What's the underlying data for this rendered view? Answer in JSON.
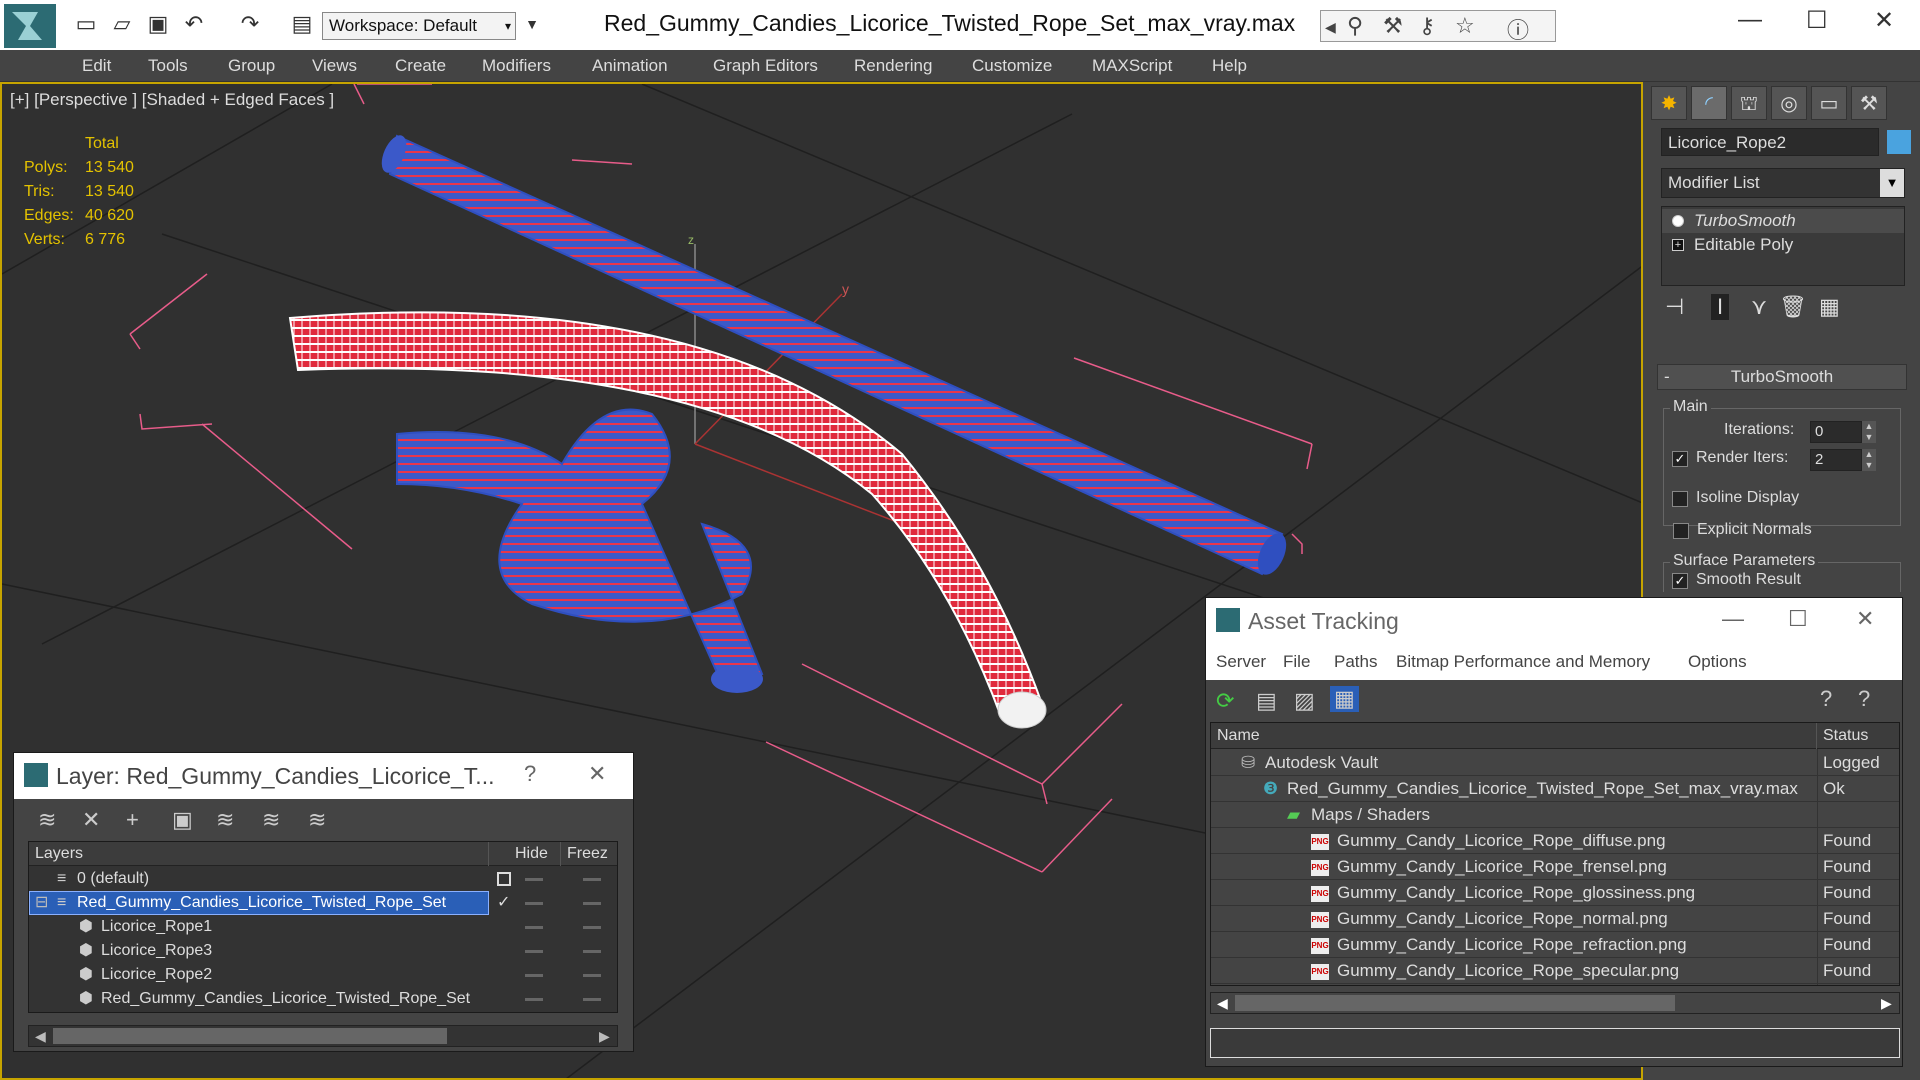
{
  "window": {
    "title": "Red_Gummy_Candies_Licorice_Twisted_Rope_Set_max_vray.max",
    "workspace": "Workspace: Default"
  },
  "menu": [
    "Edit",
    "Tools",
    "Group",
    "Views",
    "Create",
    "Modifiers",
    "Animation",
    "Graph Editors",
    "Rendering",
    "Customize",
    "MAXScript",
    "Help"
  ],
  "viewport": {
    "label": "[+] [Perspective ] [Shaded + Edged Faces ]",
    "stats": {
      "header": "Total",
      "rows": [
        {
          "k": "Polys:",
          "v": "13 540"
        },
        {
          "k": "Tris:",
          "v": "13 540"
        },
        {
          "k": "Edges:",
          "v": "40 620"
        },
        {
          "k": "Verts:",
          "v": "6 776"
        }
      ]
    },
    "axis_y": "y",
    "axis_z": "z"
  },
  "command_panel": {
    "object_name": "Licorice_Rope2",
    "object_color": "#4aa3df",
    "modifier_list": "Modifier List",
    "stack": [
      "TurboSmooth",
      "Editable Poly"
    ],
    "rollout": "TurboSmooth",
    "main_group": "Main",
    "iterations_label": "Iterations:",
    "iterations": "0",
    "render_iters_label": "Render Iters:",
    "render_iters": "2",
    "isoline": "Isoline Display",
    "explicit_normals": "Explicit Normals",
    "surface_group": "Surface Parameters",
    "smooth_result": "Smooth Result"
  },
  "layer_window": {
    "title": "Layer: Red_Gummy_Candies_Licorice_T...",
    "help": "?",
    "cols": {
      "layers": "Layers",
      "hide": "Hide",
      "freeze": "Freez"
    },
    "rows": [
      {
        "name": "0 (default)",
        "indent": 1
      },
      {
        "name": "Red_Gummy_Candies_Licorice_Twisted_Rope_Set",
        "indent": 1,
        "selected": true
      },
      {
        "name": "Licorice_Rope1",
        "indent": 2
      },
      {
        "name": "Licorice_Rope3",
        "indent": 2
      },
      {
        "name": "Licorice_Rope2",
        "indent": 2
      },
      {
        "name": "Red_Gummy_Candies_Licorice_Twisted_Rope_Set",
        "indent": 2
      }
    ]
  },
  "asset_window": {
    "title": "Asset Tracking",
    "menu": [
      "Server",
      "File",
      "Paths",
      "Bitmap Performance and Memory",
      "Options"
    ],
    "cols": {
      "name": "Name",
      "status": "Status"
    },
    "rows": [
      {
        "name": "Autodesk Vault",
        "status": "Logged",
        "indent": 0
      },
      {
        "name": "Red_Gummy_Candies_Licorice_Twisted_Rope_Set_max_vray.max",
        "status": "Ok",
        "indent": 1
      },
      {
        "name": "Maps / Shaders",
        "status": "",
        "indent": 2
      },
      {
        "name": "Gummy_Candy_Licorice_Rope_diffuse.png",
        "status": "Found",
        "indent": 3
      },
      {
        "name": "Gummy_Candy_Licorice_Rope_frensel.png",
        "status": "Found",
        "indent": 3
      },
      {
        "name": "Gummy_Candy_Licorice_Rope_glossiness.png",
        "status": "Found",
        "indent": 3
      },
      {
        "name": "Gummy_Candy_Licorice_Rope_normal.png",
        "status": "Found",
        "indent": 3
      },
      {
        "name": "Gummy_Candy_Licorice_Rope_refraction.png",
        "status": "Found",
        "indent": 3
      },
      {
        "name": "Gummy_Candy_Licorice_Rope_specular.png",
        "status": "Found",
        "indent": 3
      }
    ]
  }
}
